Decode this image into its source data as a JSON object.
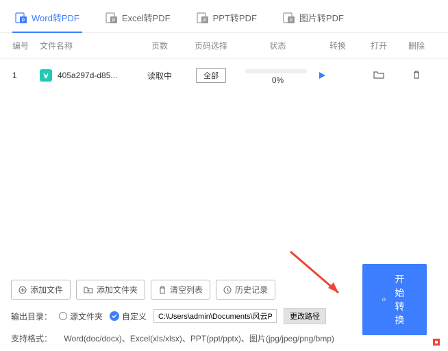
{
  "tabs": [
    {
      "label": "Word转PDF",
      "icon": "word-pdf-icon",
      "active": true
    },
    {
      "label": "Excel转PDF",
      "icon": "excel-pdf-icon",
      "active": false
    },
    {
      "label": "PPT转PDF",
      "icon": "ppt-pdf-icon",
      "active": false
    },
    {
      "label": "图片转PDF",
      "icon": "image-pdf-icon",
      "active": false
    }
  ],
  "columns": {
    "num": "编号",
    "name": "文件名称",
    "pages": "页数",
    "sel": "页码选择",
    "status": "状态",
    "convert": "转换",
    "open": "打开",
    "delete": "删除"
  },
  "rows": [
    {
      "num": "1",
      "name": "405a297d-d85...",
      "pages": "读取中",
      "sel": "全部",
      "status_pct": "0%"
    }
  ],
  "actions": {
    "add_file": "添加文件",
    "add_folder": "添加文件夹",
    "clear_list": "清空列表",
    "history": "历史记录"
  },
  "output": {
    "label": "输出目录：",
    "source_folder": "源文件夹",
    "custom": "自定义",
    "path": "C:\\Users\\admin\\Documents\\风云PDF...",
    "change": "更改路径"
  },
  "formats": {
    "label": "支持格式：",
    "text": "Word(doc/docx)、Excel(xls/xlsx)、PPT(ppt/pptx)、图片(jpg/jpeg/png/bmp)"
  },
  "start": "开始转换"
}
